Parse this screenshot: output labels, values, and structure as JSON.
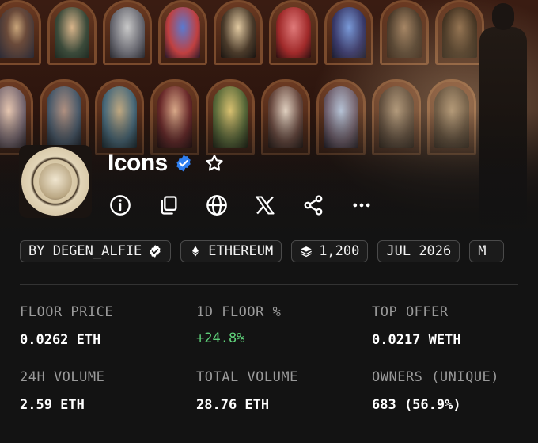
{
  "collection": {
    "title": "Icons",
    "verified_icon": "verified-badge-icon",
    "favorite_icon": "star-icon"
  },
  "actions": [
    {
      "name": "info-icon"
    },
    {
      "name": "copy-icon"
    },
    {
      "name": "globe-icon"
    },
    {
      "name": "x-logo-icon"
    },
    {
      "name": "share-icon"
    },
    {
      "name": "more-icon"
    }
  ],
  "chips": {
    "creator": "BY DEGEN_ALFIE",
    "chain": "ETHEREUM",
    "items": "1,200",
    "date": "JUL 2026",
    "cut": "M"
  },
  "stats": {
    "floor_price": {
      "label": "FLOOR PRICE",
      "value": "0.0262 ETH"
    },
    "floor_1d": {
      "label": "1D FLOOR %",
      "value": "+24.8%"
    },
    "top_offer": {
      "label": "TOP OFFER",
      "value": "0.0217 WETH"
    },
    "volume_24h": {
      "label": "24H VOLUME",
      "value": "2.59 ETH"
    },
    "total_volume": {
      "label": "TOTAL VOLUME",
      "value": "28.76 ETH"
    },
    "owners": {
      "label": "OWNERS (UNIQUE)",
      "value": "683 (56.9%)"
    }
  },
  "colors": {
    "background": "#131313",
    "positive": "#5fd17a",
    "verified": "#2f7ff0"
  }
}
